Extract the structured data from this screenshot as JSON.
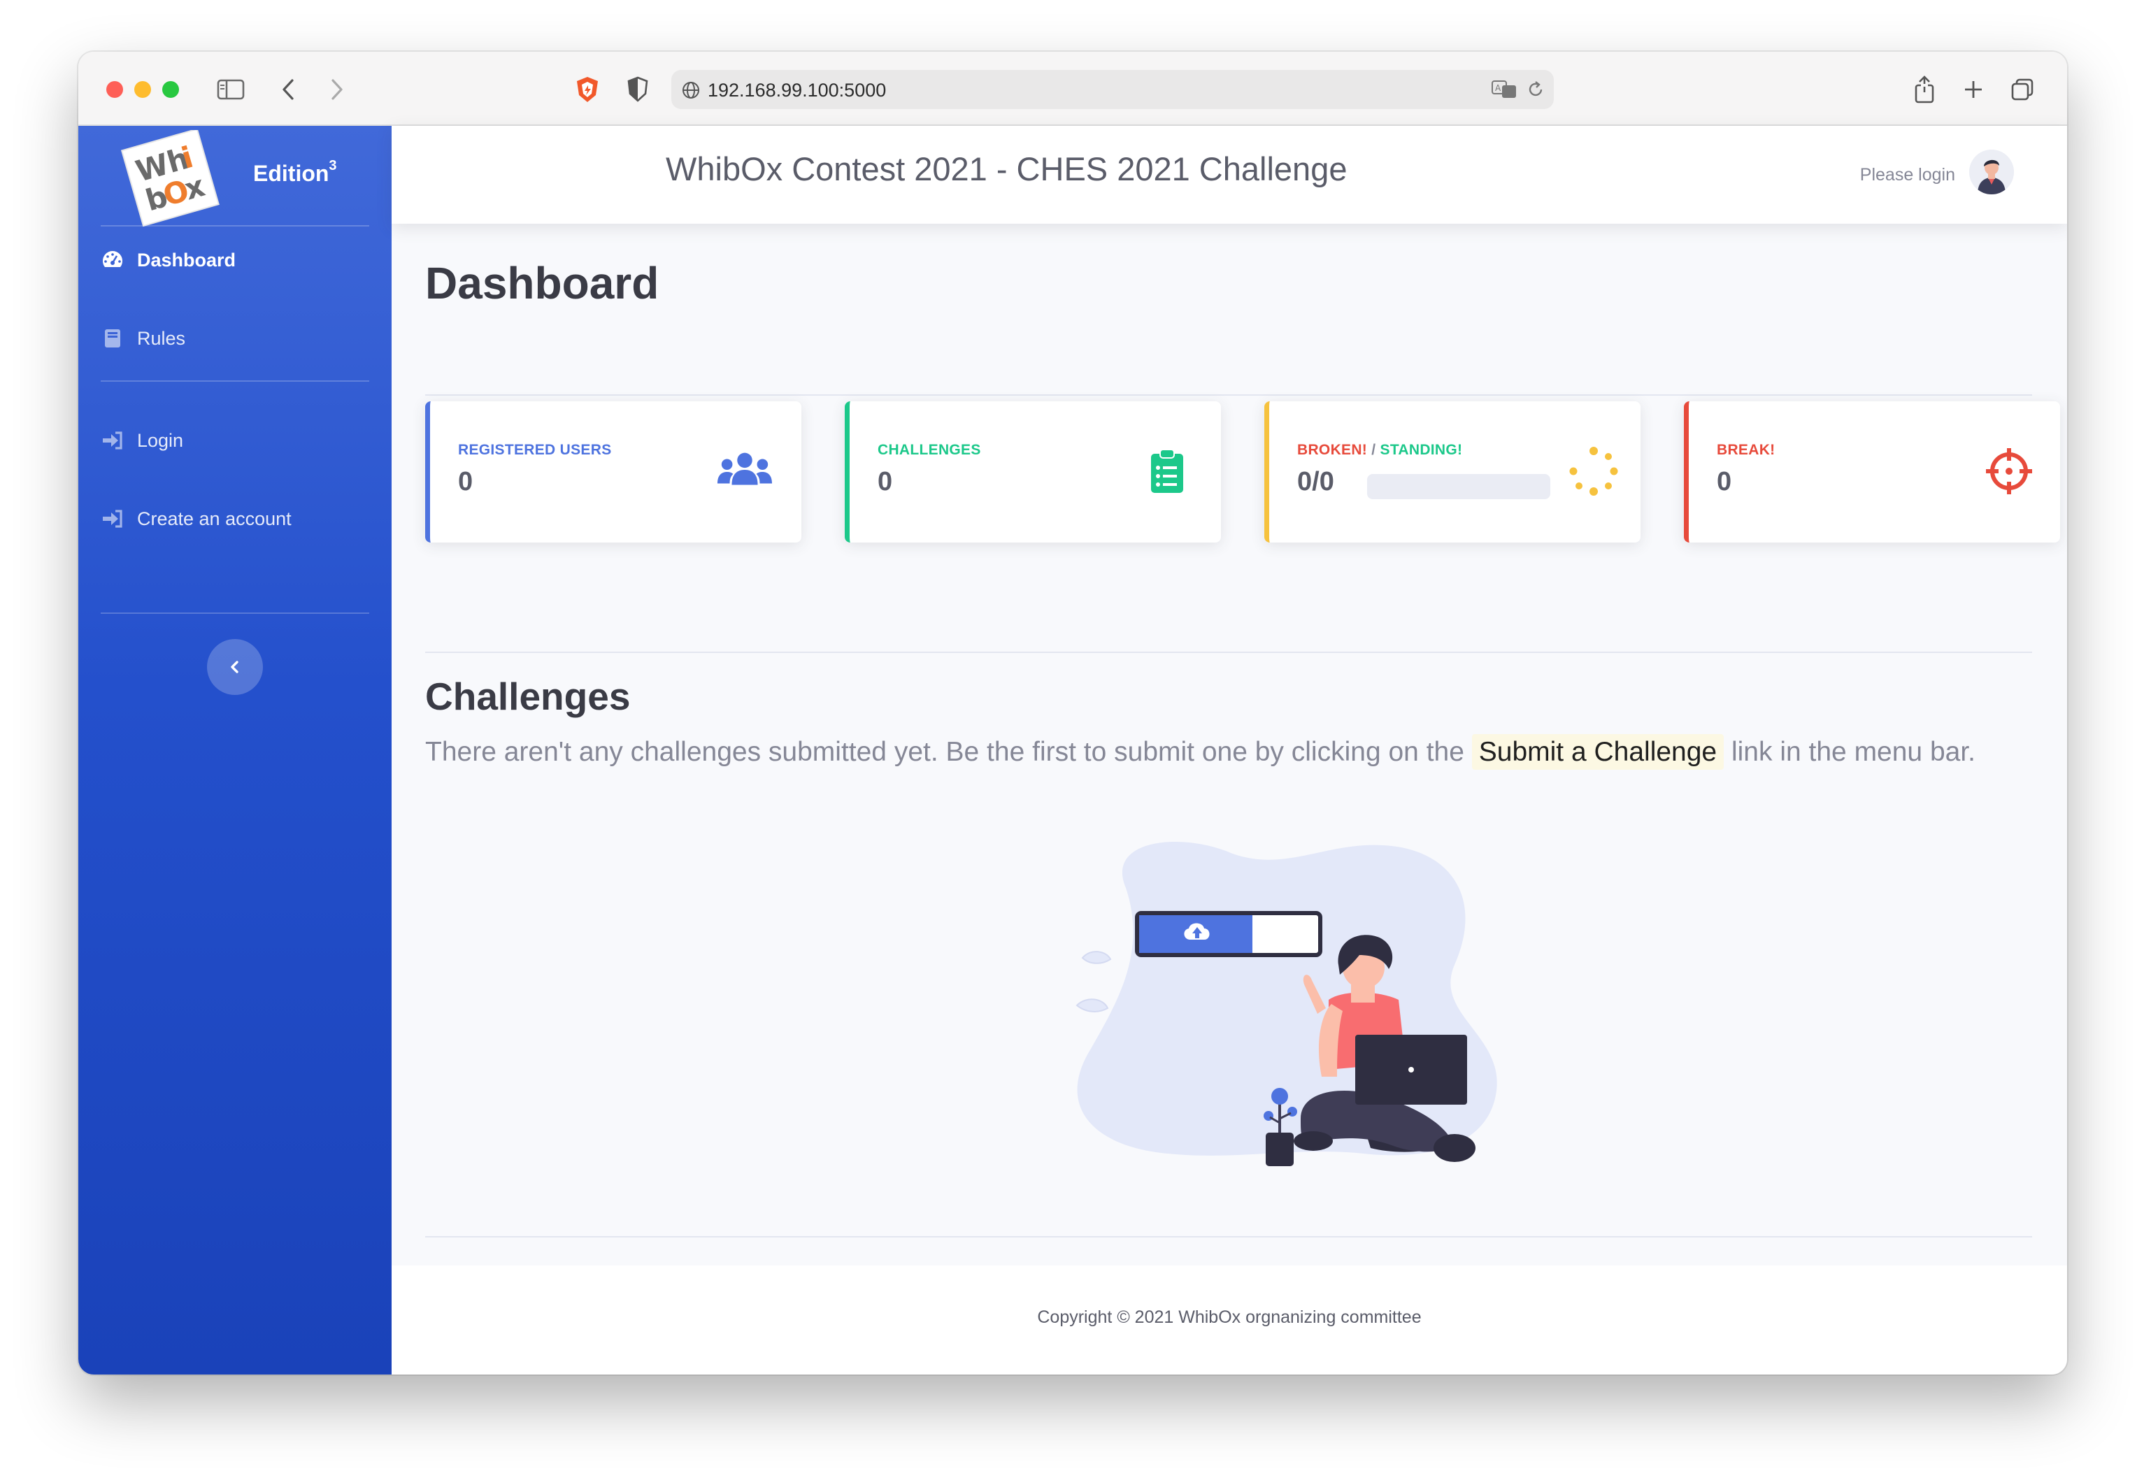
{
  "browser": {
    "url": "192.168.99.100:5000"
  },
  "sidebar": {
    "brand_logo_text": "Whi bOx",
    "edition_label": "Edition",
    "edition_sup": "3",
    "items": [
      {
        "label": "Dashboard",
        "icon": "tachometer-icon",
        "active": true
      },
      {
        "label": "Rules",
        "icon": "book-icon",
        "active": false
      },
      {
        "label": "Login",
        "icon": "sign-in-icon",
        "active": false
      },
      {
        "label": "Create an account",
        "icon": "sign-in-icon",
        "active": false
      }
    ],
    "collapse_icon": "chevron-left-icon"
  },
  "topbar": {
    "title": "WhibOx Contest 2021 - CHES 2021 Challenge",
    "login_text": "Please login"
  },
  "main": {
    "page_title": "Dashboard",
    "cards": [
      {
        "label": "REGISTERED USERS",
        "value": "0",
        "color": "#4e73df",
        "icon": "users-icon"
      },
      {
        "label": "CHALLENGES",
        "value": "0",
        "color": "#1cc88a",
        "icon": "clipboard-list-icon"
      },
      {
        "label_broken": "BROKEN!",
        "label_sep": " / ",
        "label_standing": "STANDING!",
        "value": "0/0",
        "progress": 0,
        "color": "#f6c23e",
        "icon": "spinner-icon"
      },
      {
        "label": "BREAK!",
        "value": "0",
        "color": "#e74a3b",
        "icon": "crosshairs-icon"
      }
    ],
    "challenges_title": "Challenges",
    "intro_before": "There aren't any challenges submitted yet. Be the first to submit one by clicking on the",
    "intro_link": "Submit a Challenge",
    "intro_after": "link in the menu bar."
  },
  "footer": {
    "text": "Copyright © 2021 WhibOx orgnanizing committee"
  },
  "colors": {
    "sidebar_top": "#4169d9",
    "sidebar_bottom": "#1a42b9",
    "primary": "#4e73df",
    "success": "#1cc88a",
    "warning": "#f6c23e",
    "danger": "#e74a3b"
  }
}
